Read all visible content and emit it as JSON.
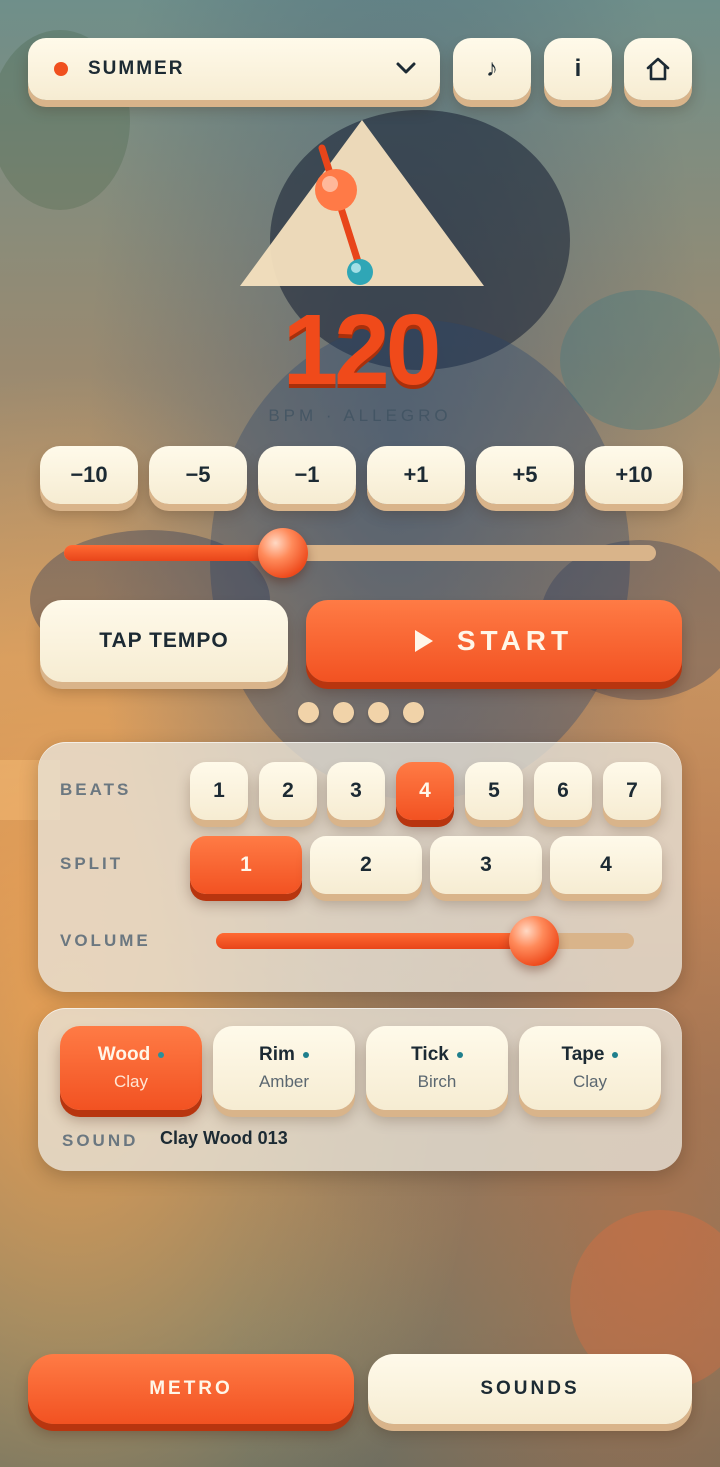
{
  "topbar": {
    "preset_label": "SUMMER",
    "music_label": "♪",
    "info_label": "i"
  },
  "tempo": {
    "bpm": "120",
    "subtitle": "BPM · ALLEGRO",
    "slider_value_fraction": 0.37
  },
  "steps": [
    "−10",
    "−5",
    "−1",
    "+1",
    "+5",
    "+10"
  ],
  "actions": {
    "tap_label": "TAP TEMPO",
    "start_label": "START"
  },
  "pager": {
    "count": 4,
    "active": 0
  },
  "rhythm": {
    "beats_label": "BEATS",
    "beats": [
      "1",
      "2",
      "3",
      "4",
      "5",
      "6",
      "7"
    ],
    "selected_beat": "4",
    "split_label": "SPLIT",
    "splits": [
      "1",
      "2",
      "3",
      "4"
    ],
    "selected_split": "1",
    "volume_label": "VOLUME",
    "volume_fraction": 0.76
  },
  "sounds": {
    "cards": [
      {
        "name": "Wood",
        "sub": "Clay"
      },
      {
        "name": "Rim",
        "sub": "Amber"
      },
      {
        "name": "Tick",
        "sub": "Birch"
      },
      {
        "name": "Tape",
        "sub": "Clay"
      }
    ],
    "selected": "Wood",
    "sound_label": "SOUND",
    "sound_value": "Clay Wood 013"
  },
  "bottom_nav": {
    "metro_label": "METRO",
    "sounds_label": "SOUNDS"
  },
  "colors": {
    "accent": "#f25222",
    "cream": "#fffaea",
    "text_dark": "#1c2a33"
  }
}
